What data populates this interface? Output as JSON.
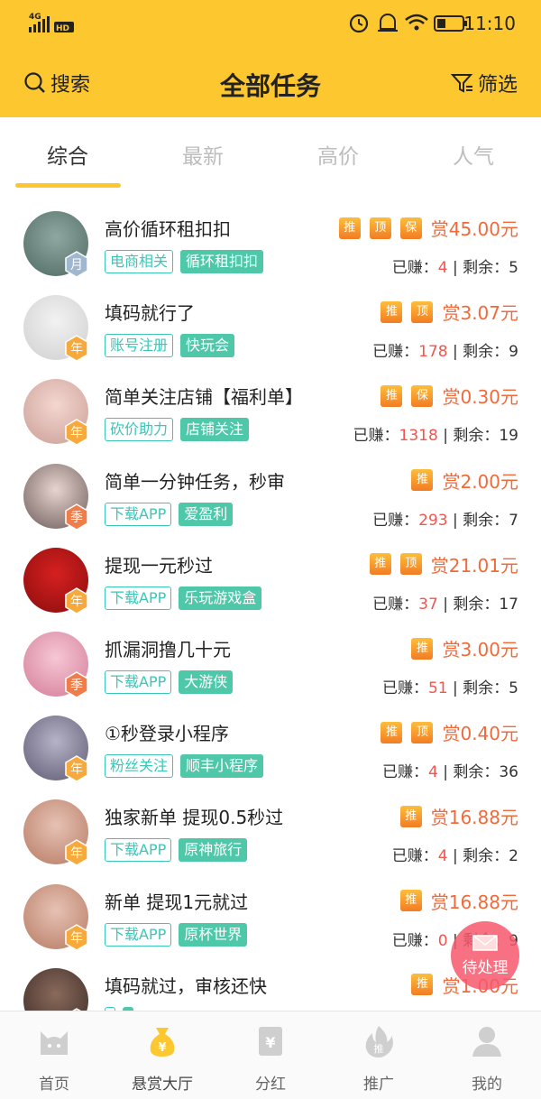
{
  "status_bar": {
    "network": "4G",
    "hd": "HD",
    "time": "11:10"
  },
  "nav": {
    "search_label": "搜索",
    "title": "全部任务",
    "filter_label": "筛选"
  },
  "tabs": [
    {
      "label": "综合",
      "active": true
    },
    {
      "label": "最新",
      "active": false
    },
    {
      "label": "高价",
      "active": false
    },
    {
      "label": "人气",
      "active": false
    }
  ],
  "tasks": [
    {
      "title": "高价循环租扣扣",
      "badge": "月",
      "tags": [
        "电商相关",
        "循环租扣扣"
      ],
      "icons": [
        "推",
        "顶",
        "保"
      ],
      "reward": "赏45.00元",
      "earned_label": "已赚：",
      "earned": "4",
      "sep": " | 剩余：",
      "remaining": "5"
    },
    {
      "title": "填码就行了",
      "badge": "年",
      "tags": [
        "账号注册",
        "快玩会"
      ],
      "icons": [
        "推",
        "顶"
      ],
      "reward": "赏3.07元",
      "earned_label": "已赚：",
      "earned": "178",
      "sep": " | 剩余：",
      "remaining": "9"
    },
    {
      "title": "简单关注店铺【福利单】",
      "badge": "年",
      "tags": [
        "砍价助力",
        "店铺关注"
      ],
      "icons": [
        "推",
        "保"
      ],
      "reward": "赏0.30元",
      "earned_label": "已赚：",
      "earned": "1318",
      "sep": " | 剩余：",
      "remaining": "19"
    },
    {
      "title": "简单一分钟任务，秒审",
      "badge": "季",
      "tags": [
        "下载APP",
        "爱盈利"
      ],
      "icons": [
        "推"
      ],
      "reward": "赏2.00元",
      "earned_label": "已赚：",
      "earned": "293",
      "sep": " | 剩余：",
      "remaining": "7"
    },
    {
      "title": "提现一元秒过",
      "badge": "年",
      "tags": [
        "下载APP",
        "乐玩游戏盒"
      ],
      "icons": [
        "推",
        "顶"
      ],
      "reward": "赏21.01元",
      "earned_label": "已赚：",
      "earned": "37",
      "sep": " | 剩余：",
      "remaining": "17"
    },
    {
      "title": "抓漏洞撸几十元",
      "badge": "季",
      "tags": [
        "下载APP",
        "大游侠"
      ],
      "icons": [
        "推"
      ],
      "reward": "赏3.00元",
      "earned_label": "已赚：",
      "earned": "51",
      "sep": " | 剩余：",
      "remaining": "5"
    },
    {
      "title": "①秒登录小程序",
      "badge": "年",
      "tags": [
        "粉丝关注",
        "顺丰小程序"
      ],
      "icons": [
        "推",
        "顶"
      ],
      "reward": "赏0.40元",
      "earned_label": "已赚：",
      "earned": "4",
      "sep": " | 剩余：",
      "remaining": "36"
    },
    {
      "title": "独家新单 提现0.5秒过",
      "badge": "年",
      "tags": [
        "下载APP",
        "原神旅行"
      ],
      "icons": [
        "推"
      ],
      "reward": "赏16.88元",
      "earned_label": "已赚：",
      "earned": "4",
      "sep": " | 剩余：",
      "remaining": "2"
    },
    {
      "title": "新单 提现1元就过",
      "badge": "年",
      "tags": [
        "下载APP",
        "原杯世界"
      ],
      "icons": [
        "推"
      ],
      "reward": "赏16.88元",
      "earned_label": "已赚：",
      "earned": "0",
      "sep": " | 剩余：",
      "remaining": "9"
    },
    {
      "title": "填码就过，审核还快",
      "badge": "年",
      "tags": [
        "",
        ""
      ],
      "icons": [
        "推"
      ],
      "reward": "赏1.00元",
      "earned_label": "",
      "earned": "",
      "sep": "",
      "remaining": ""
    }
  ],
  "float_button": {
    "label": "待处理"
  },
  "bottom_nav": [
    {
      "label": "首页",
      "icon": "cat-home-icon",
      "active": false
    },
    {
      "label": "悬赏大厅",
      "icon": "money-bag-icon",
      "active": true
    },
    {
      "label": "分红",
      "icon": "yen-card-icon",
      "active": false
    },
    {
      "label": "推广",
      "icon": "flame-promote-icon",
      "active": false
    },
    {
      "label": "我的",
      "icon": "user-icon",
      "active": false
    }
  ],
  "colors": {
    "brand_yellow": "#fdc72f",
    "reward_orange": "#f06a3a",
    "tag_teal": "#3cc6b7",
    "earned_red": "#f2554d",
    "float_pink": "#f7586c"
  }
}
